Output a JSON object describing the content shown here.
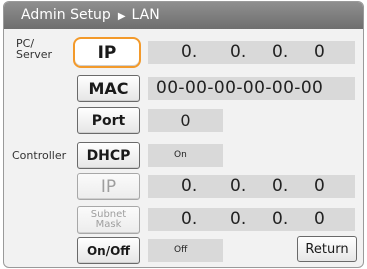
{
  "header": {
    "title": "Admin Setup",
    "separator_icon": "triangle-right-icon",
    "subtitle": "LAN"
  },
  "sections": {
    "pc_server_label": "PC/\nServer",
    "controller_label": "Controller"
  },
  "pc_server": {
    "ip": {
      "label": "IP",
      "octets": [
        "0.",
        "0.",
        "0.",
        "0"
      ]
    },
    "mac": {
      "label": "MAC",
      "value": "00-00-00-00-00-00"
    },
    "port": {
      "label": "Port",
      "value": "0"
    }
  },
  "controller": {
    "dhcp": {
      "label": "DHCP",
      "value": "On"
    },
    "ip": {
      "label": "IP",
      "octets": [
        "0.",
        "0.",
        "0.",
        "0"
      ]
    },
    "subnet_mask": {
      "label": "Subnet\nMask",
      "octets": [
        "0.",
        "0.",
        "0.",
        "0"
      ]
    },
    "onoff": {
      "label": "On/Off",
      "value": "Off"
    }
  },
  "actions": {
    "return_label": "Return"
  },
  "colors": {
    "header_bg": "#7d7d7d",
    "selected_outline": "#f39a2b",
    "field_bg": "#d9d9d9"
  }
}
